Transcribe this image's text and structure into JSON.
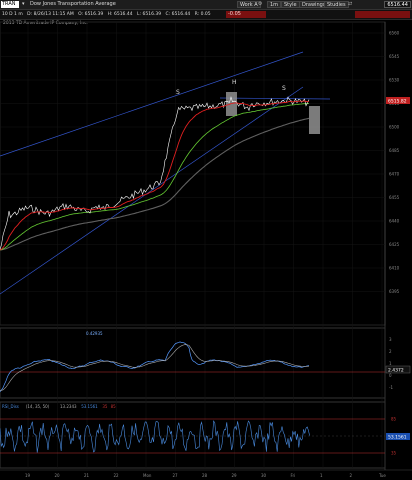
{
  "toolbar": {
    "symbol": "TRAN",
    "description": "Dow Jones Transportation Average",
    "workspace": "Work A",
    "timeframe": "1m",
    "style_label": "Style",
    "drawings_label": "Drawings",
    "studies_label": "Studies",
    "last_price": "6516.44"
  },
  "quote_bar": {
    "interval": "10 D 1 m",
    "datetime": "D: 8/26/13 11:15 AM",
    "open": "O: 6516.39",
    "high": "H: 6516.44",
    "low": "L: 6516.39",
    "close": "C: 6516.44",
    "change": "R: 0.05",
    "extra": "-0.05"
  },
  "company_line": "2013 TD Ameritrade IP Company, Inc.",
  "main_chart": {
    "price_axis": [
      "6560",
      "6545",
      "6530",
      "6515",
      "6500",
      "6485",
      "6470",
      "6455",
      "6440",
      "6425",
      "6410",
      "6395"
    ],
    "current_price": "6515.82",
    "pattern_labels": [
      "S",
      "H",
      "S"
    ]
  },
  "indicator1": {
    "value_label": "0.42935",
    "axis_labels": [
      "3",
      "2",
      "1",
      "0",
      "-1"
    ],
    "current": "2.4372"
  },
  "indicator2": {
    "title_parts": [
      "RSI_Diss",
      "(14, 35, 50)",
      "13.2343",
      "53.1561",
      "35",
      "85"
    ],
    "axis_labels": [
      "85",
      "50",
      "35"
    ],
    "current": "53.1561"
  },
  "time_axis": [
    "19",
    "20",
    "21",
    "22",
    "Mon",
    "27",
    "28",
    "29",
    "30",
    "Fri",
    "1",
    "2",
    "Tue"
  ],
  "colors": {
    "price": "#ffffff",
    "ema_fast": "#e02020",
    "ema_mid": "#66cc33",
    "ema_slow": "#606060",
    "trendline": "#3355cc",
    "indicator_line": "#5599ff",
    "threshold": "#c03030"
  }
}
